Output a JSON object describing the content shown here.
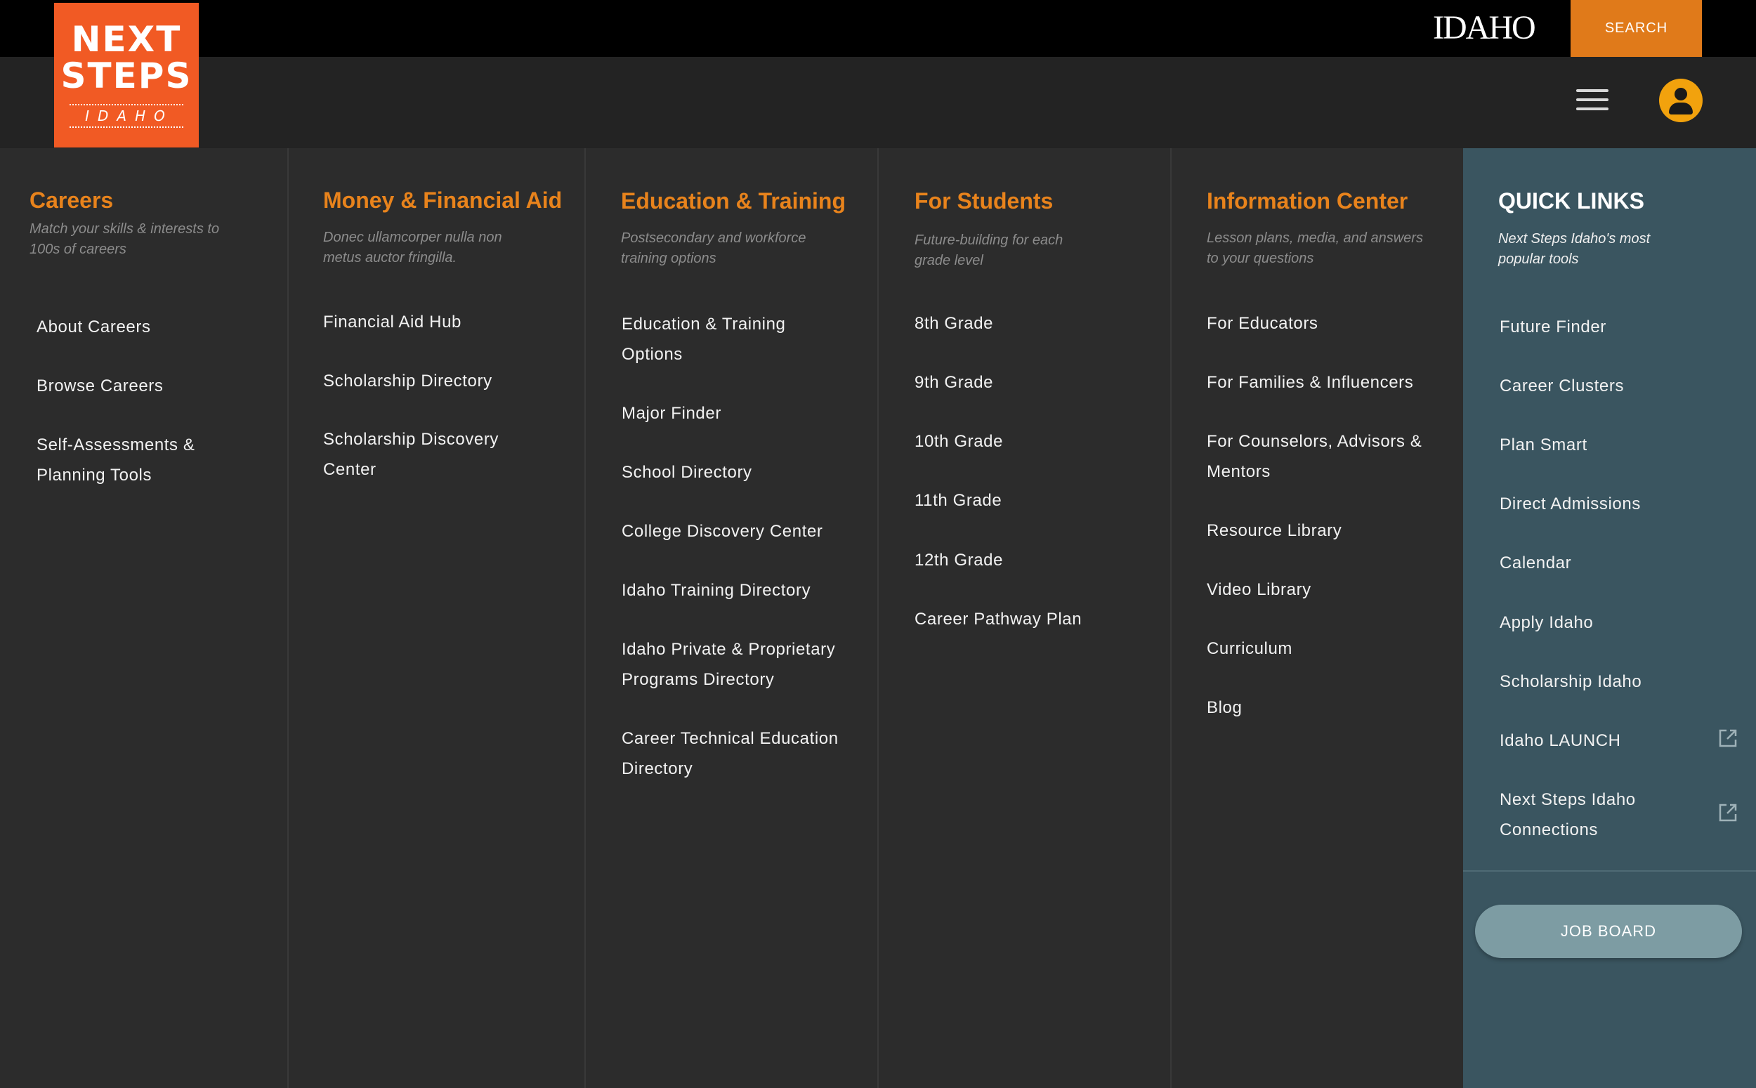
{
  "header": {
    "logo": {
      "line1": "NEXT",
      "line2": "STEPS",
      "line3": "IDAHO"
    },
    "state_brand": "IDAHO",
    "search_label": "SEARCH",
    "menu_icon": "hamburger-menu-icon",
    "account_icon": "user-avatar-icon",
    "accent_color": "#e07a1a"
  },
  "columns": {
    "careers": {
      "title": "Careers",
      "description": "Match your skills & interests to 100s of careers",
      "items": [
        "About Careers",
        "Browse Careers",
        "Self-Assessments & Planning Tools"
      ]
    },
    "money": {
      "title": "Money & Financial Aid",
      "description": "Donec ullamcorper nulla non metus auctor fringilla.",
      "items": [
        "Financial Aid Hub",
        "Scholarship Directory",
        "Scholarship Discovery Center"
      ]
    },
    "education": {
      "title": "Education & Training",
      "description": "Postsecondary and workforce training options",
      "items": [
        "Education & Training Options",
        "Major Finder",
        "School Directory",
        "College Discovery Center",
        "Idaho Training Directory",
        "Idaho Private & Proprietary Programs Directory",
        "Career Technical Education Directory"
      ]
    },
    "students": {
      "title": "For Students",
      "description": "Future-building for each grade level",
      "items": [
        "8th Grade",
        "9th Grade",
        "10th Grade",
        "11th Grade",
        "12th Grade",
        "Career Pathway Plan"
      ]
    },
    "info": {
      "title": "Information Center",
      "description": "Lesson plans, media, and answers to your questions",
      "items": [
        "For Educators",
        "For Families & Influencers",
        "For Counselors, Advisors & Mentors",
        "Resource Library",
        "Video Library",
        "Curriculum",
        "Blog"
      ]
    },
    "quick": {
      "title": "QUICK LINKS",
      "description": "Next Steps Idaho's most popular tools",
      "items": [
        "Future Finder",
        "Career Clusters",
        "Plan Smart",
        "Direct Admissions",
        "Calendar",
        "Apply Idaho",
        "Scholarship Idaho",
        "Idaho LAUNCH",
        "Next Steps Idaho Connections"
      ],
      "external_icon": "external-link-icon",
      "job_board_label": "JOB BOARD"
    }
  },
  "colors": {
    "heading_orange": "#e8831c",
    "panel_bg": "#2c2c2c",
    "quick_links_bg": "#3a5560",
    "logo_bg": "#f15a24",
    "avatar_bg": "#f2a20d"
  }
}
